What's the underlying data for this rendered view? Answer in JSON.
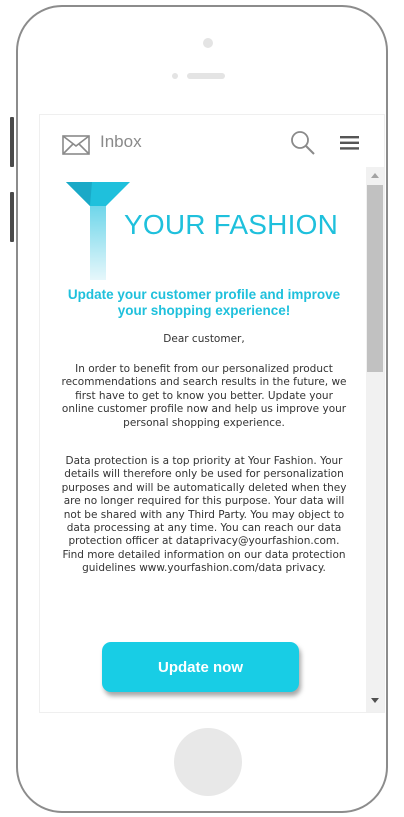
{
  "topbar": {
    "inbox_label": "Inbox",
    "icons": [
      "mail-icon",
      "search-icon",
      "menu-icon"
    ]
  },
  "email": {
    "logo_text": "YOUR FASHION",
    "headline": "Update your customer profile and improve your shopping experience!",
    "greeting": "Dear customer,",
    "paragraph1": "In order to benefit from our personalized product recommendations and search results in the future, we first have to get to know you better. Update your online customer profile now and help us improve your personal shopping experience.",
    "paragraph2": "Data protection is a top priority at Your Fashion. Your details will therefore only be used for personalization purposes and will be automatically deleted when they are no longer required for this purpose. Your data will not be shared with any Third Party. You may object to data processing at any time. You can reach our data protection officer at dataprivacy@yourfashion.com. Find more detailed information on our data protection guidelines www.yourfashion.com/data privacy.",
    "cta_label": "Update now"
  },
  "colors": {
    "brand_cyan": "#1fc0dc",
    "button_cyan": "#18cde5"
  }
}
